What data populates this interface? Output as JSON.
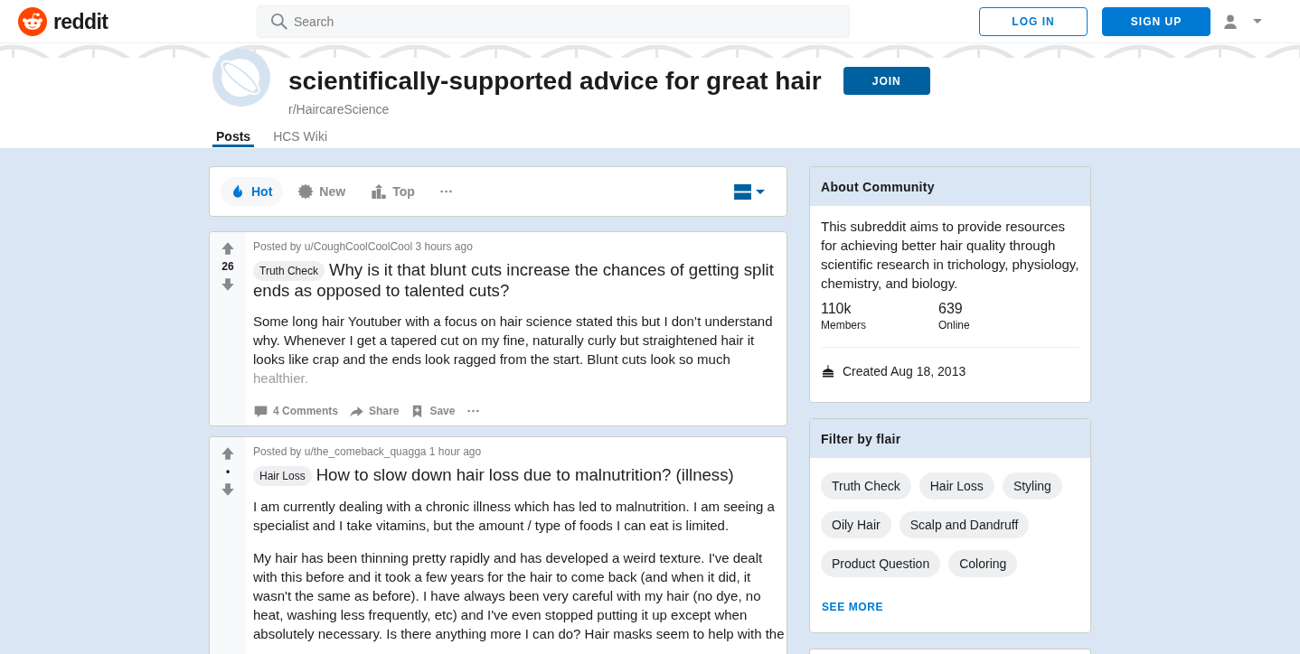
{
  "header": {
    "logo_text": "reddit",
    "search": {
      "placeholder": "Search"
    },
    "buttons": [
      {
        "label": "LOG IN",
        "kind": "login"
      },
      {
        "label": "SIGN UP",
        "kind": "signup"
      }
    ]
  },
  "community": {
    "title": "scientifically-supported advice for great hair",
    "name": "r/HaircareScience",
    "join_button": "JOIN",
    "tabs": [
      {
        "label": "Posts",
        "selected": true
      },
      {
        "label": "HCS Wiki",
        "selected": false
      }
    ]
  },
  "sort_bar": {
    "options": [
      {
        "label": "Hot",
        "kind": "hot",
        "selected": true
      },
      {
        "label": "New",
        "kind": "new",
        "selected": false
      },
      {
        "label": "Top",
        "kind": "top",
        "selected": false
      }
    ]
  },
  "posts": [
    {
      "score": "26",
      "byline": "Posted by u/CoughCoolCoolCool 3 hours ago",
      "flair": "Truth Check",
      "title": "Why is it that blunt cuts increase the chances of getting split ends as opposed to talented cuts?",
      "body": [
        "Some long hair Youtuber with a focus on hair science stated this but I don’t understand why. Whenever I get a tapered cut on my fine, naturally curly but straightened hair it looks like crap and the ends look ragged from the start. Blunt cuts look so much healthier."
      ],
      "truncated": true,
      "actions": [
        {
          "label": "4 Comments",
          "kind": "comments"
        },
        {
          "label": "Share",
          "kind": "share"
        },
        {
          "label": "Save",
          "kind": "save"
        }
      ]
    },
    {
      "score": "•",
      "byline": "Posted by u/the_comeback_quagga 1 hour ago",
      "flair": "Hair Loss",
      "title": "How to slow down hair loss due to malnutrition? (illness)",
      "body": [
        "I am currently dealing with a chronic illness which has led to malnutrition. I am seeing a specialist and I take vitamins, but the amount / type of foods I can eat is limited.",
        "My hair has been thinning pretty rapidly and has developed a weird texture. I've dealt with this before and it took a few years for the hair to come back (and when it did, it wasn't the same as before). I have always been very careful with my hair (no dye, no heat, washing less frequently, etc) and I've even stopped putting it up except when absolutely necessary. Is there anything more I can do? Hair masks seem to help with the"
      ],
      "truncated": false
    }
  ],
  "sidebar": {
    "about": {
      "title": "About Community",
      "description": "This subreddit aims to provide resources for achieving better hair quality through scientific research in trichology, physiology, chemistry, and biology.",
      "stats": [
        {
          "value": "110k",
          "label": "Members"
        },
        {
          "value": "639",
          "label": "Online"
        }
      ],
      "created": "Created Aug 18, 2013"
    },
    "flair_filter": {
      "title": "Filter by flair",
      "flairs": [
        "Truth Check",
        "Hair Loss",
        "Styling",
        "Oily Hair",
        "Scalp and Dandruff",
        "Product Question",
        "Coloring"
      ],
      "see_more": "SEE MORE"
    }
  }
}
